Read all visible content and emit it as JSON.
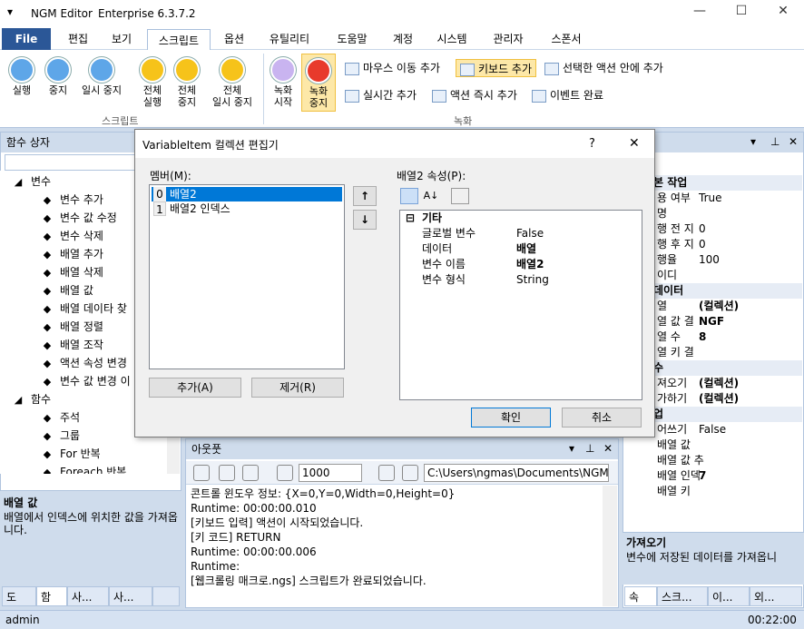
{
  "app": {
    "title": "NGM Editor",
    "edition": "Enterprise 6.3.7.2"
  },
  "menu": [
    "File",
    "편집",
    "보기",
    "스크립트",
    "옵션",
    "유틸리티",
    "도움말",
    "계정",
    "시스템",
    "관리자",
    "스폰서"
  ],
  "ribbon": {
    "script_buttons": [
      {
        "label": "실행",
        "sub": ""
      },
      {
        "label": "중지",
        "sub": ""
      },
      {
        "label": "일시 중지",
        "sub": ""
      },
      {
        "label": "전체",
        "sub": "실행"
      },
      {
        "label": "전체",
        "sub": "중지"
      },
      {
        "label": "전체",
        "sub": "일시 중지"
      }
    ],
    "script_group": "스크립트",
    "record_buttons": [
      {
        "label": "녹화",
        "sub": "시작"
      },
      {
        "label": "녹화",
        "sub": "중지"
      }
    ],
    "record_small": [
      "마우스 이동 추가",
      "키보드 추가",
      "선택한 액션 안에 추가",
      "실시간 추가",
      "액션 즉시 추가",
      "이벤트 완료"
    ],
    "record_group": "녹화"
  },
  "left_panel": {
    "title": "함수 상자",
    "tree": [
      {
        "label": "변수",
        "level": 0
      },
      {
        "label": "변수 추가",
        "level": 1
      },
      {
        "label": "변수 값 수정",
        "level": 1
      },
      {
        "label": "변수 삭제",
        "level": 1
      },
      {
        "label": "배열 추가",
        "level": 1
      },
      {
        "label": "배열 삭제",
        "level": 1
      },
      {
        "label": "배열 값",
        "level": 1
      },
      {
        "label": "배열 데이타 찾",
        "level": 1
      },
      {
        "label": "배열 정렬",
        "level": 1
      },
      {
        "label": "배열 조작",
        "level": 1
      },
      {
        "label": "액션 속성 변경",
        "level": 1
      },
      {
        "label": "변수 값 변경 이",
        "level": 1
      },
      {
        "label": "함수",
        "level": 0
      },
      {
        "label": "주석",
        "level": 1
      },
      {
        "label": "그룹",
        "level": 1
      },
      {
        "label": "For 반복",
        "level": 1
      },
      {
        "label": "Foreach 반복",
        "level": 1
      }
    ],
    "desc_title": "배열 값",
    "desc_text": "배열에서 인덱스에 위치한 값을 가져옵니다.",
    "tabs": [
      "도",
      "함",
      "사...",
      "사...",
      ""
    ]
  },
  "dialog": {
    "title": "VariableItem 컬렉션 편집기",
    "help": "?",
    "close": "✕",
    "members_label": "멤버(M):",
    "members": [
      {
        "idx": "0",
        "name": "배열2"
      },
      {
        "idx": "1",
        "name": "배열2 인덱스"
      }
    ],
    "add": "추가(A)",
    "remove": "제거(R)",
    "props_label": "배열2 속성(P):",
    "category": "기타",
    "props": [
      {
        "name": "글로벌 변수",
        "value": "False",
        "bold": false
      },
      {
        "name": "데이터",
        "value": "배열",
        "bold": true
      },
      {
        "name": "변수 이름",
        "value": "배열2",
        "bold": true
      },
      {
        "name": "변수 형식",
        "value": "String",
        "bold": false
      }
    ],
    "ok": "확인",
    "cancel": "취소"
  },
  "output": {
    "title": "아웃풋",
    "count": "1000",
    "path": "C:\\Users\\ngmas\\Documents\\NGM6\\",
    "lines": [
      "콘트롤 윈도우 정보: {X=0,Y=0,Width=0,Height=0}",
      "Runtime: 00:00:00.010",
      "[키보드 입력] 액션이 시작되었습니다.",
      "[키 코드] RETURN",
      "Runtime: 00:00:00.006",
      "Runtime:",
      "[웹크롤링 매크로.ngs] 스크립트가 완료되었습니다."
    ]
  },
  "right_panel": {
    "rows": [
      {
        "name": "본 작업",
        "value": "",
        "cat": true
      },
      {
        "name": "용 여부",
        "value": "True",
        "cat": false
      },
      {
        "name": "명",
        "value": "",
        "cat": false
      },
      {
        "name": "행 전 지",
        "value": "0",
        "cat": false
      },
      {
        "name": "행 후 지",
        "value": "0",
        "cat": false
      },
      {
        "name": "행율",
        "value": "100",
        "cat": false
      },
      {
        "name": "이디",
        "value": "",
        "cat": false
      },
      {
        "name": "데이터",
        "value": "",
        "cat": true
      },
      {
        "name": "열",
        "value": "(컬렉션)",
        "cat": false,
        "bold": true
      },
      {
        "name": "열 값 결",
        "value": "NGF",
        "cat": false,
        "bold": true
      },
      {
        "name": "열 수",
        "value": "8",
        "cat": false,
        "bold": true
      },
      {
        "name": "열 키 결",
        "value": "",
        "cat": false
      },
      {
        "name": "수",
        "value": "",
        "cat": true
      },
      {
        "name": "져오기",
        "value": "(컬렉션)",
        "cat": false,
        "bold": true
      },
      {
        "name": "가하기",
        "value": "(컬렉션)",
        "cat": false,
        "bold": true
      },
      {
        "name": "업",
        "value": "",
        "cat": true
      },
      {
        "name": "어쓰기",
        "value": "False",
        "cat": false
      },
      {
        "name": "배열 값",
        "value": "",
        "cat": false
      },
      {
        "name": "배열 값 추",
        "value": "",
        "cat": false
      },
      {
        "name": "배열 인덱",
        "value": "7",
        "cat": false,
        "bold": true
      },
      {
        "name": "배열 키",
        "value": "",
        "cat": false
      }
    ],
    "desc_title": "가져오기",
    "desc_text": "변수에 저장된 데이터를 가져옵니",
    "tabs": [
      "속",
      "스크...",
      "이...",
      "외..."
    ]
  },
  "status": {
    "user": "admin",
    "time": "00:22:00"
  }
}
